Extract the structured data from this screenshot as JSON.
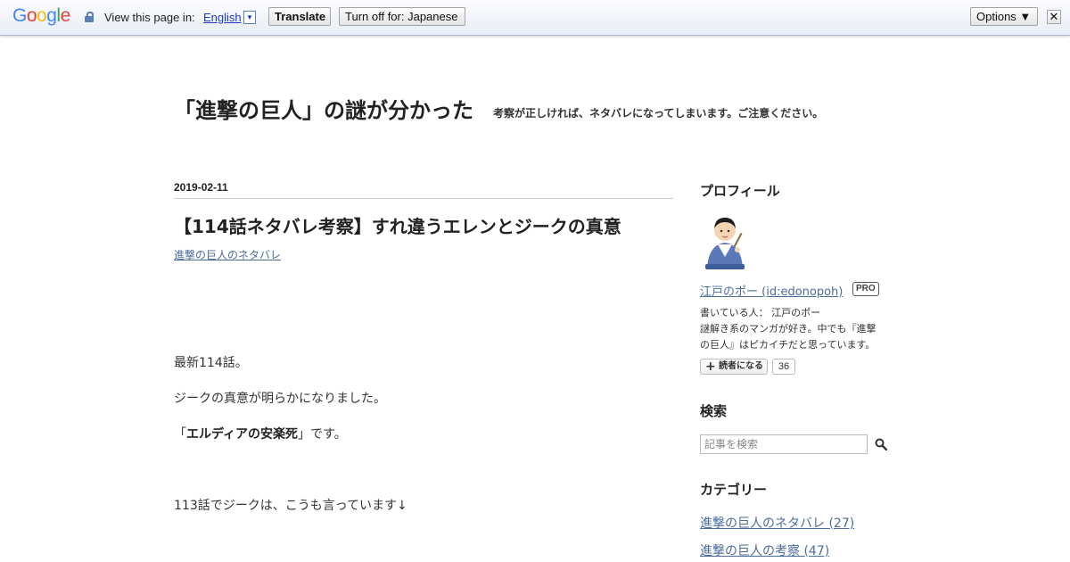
{
  "translate_bar": {
    "logo": "Google",
    "view_in_label": "View this page in:",
    "language": "English",
    "language_arrow": "▼",
    "translate_button": "Translate",
    "turn_off_button": "Turn off for: Japanese",
    "options_button": "Options ▼",
    "close_button": "✕"
  },
  "blog": {
    "title": "「進撃の巨人」の謎が分かった",
    "description": "考察が正しければ、ネタバレになってしまいます。ご注意ください。"
  },
  "entry": {
    "date": "2019-02-11",
    "title": "【114話ネタバレ考察】すれ違うエレンとジークの真意",
    "category": "進撃の巨人のネタバレ",
    "paragraphs": {
      "p1": "最新114話。",
      "p2": "ジークの真意が明らかになりました。",
      "p3_prefix": "「",
      "p3_bold": "エルディアの安楽死",
      "p3_suffix": "」です。",
      "p4": "113話でジークは、こうも言っています↓"
    }
  },
  "sidebar": {
    "profile": {
      "heading": "プロフィール",
      "name_link": "江戸のポー (id:edonopoh)",
      "pro_badge": "PRO",
      "line1": "書いている人： 江戸のポー",
      "line2": "謎解き系のマンガが好き。中でも『進撃",
      "line3": "の巨人』はピカイチだと思っています。",
      "follow_label": "読者になる",
      "follow_count": "36"
    },
    "search": {
      "heading": "検索",
      "placeholder": "記事を検索"
    },
    "categories": {
      "heading": "カテゴリー",
      "items": [
        "進撃の巨人のネタバレ (27)",
        "進撃の巨人の考察 (47)"
      ]
    }
  },
  "colors": {
    "link": "#4a6d9c",
    "translate_link": "#1a3dc1",
    "text": "#333333"
  }
}
